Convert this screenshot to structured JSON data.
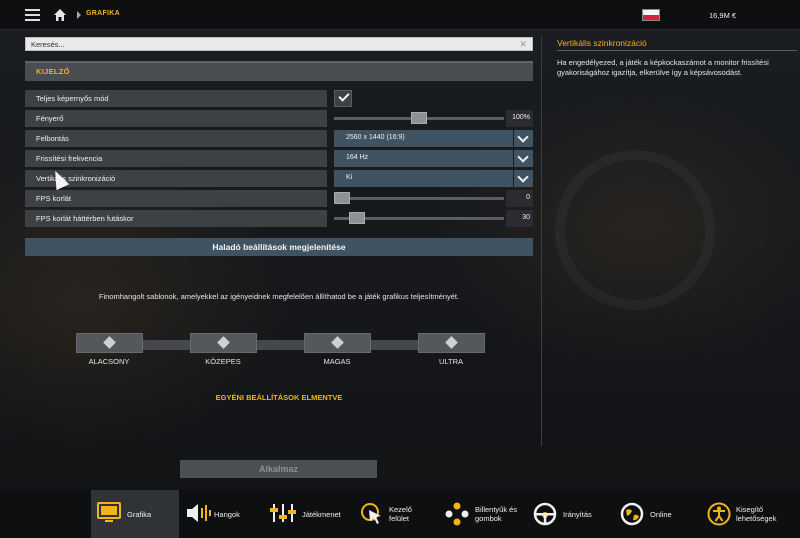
{
  "topbar": {
    "breadcrumb": "GRAFIKA",
    "money": "16,9M €"
  },
  "search": {
    "placeholder": "Keresés..."
  },
  "section": {
    "title": "KIJELZŐ"
  },
  "settings": [
    {
      "label": "Teljes képernyős mód",
      "type": "checkbox",
      "checked": true
    },
    {
      "label": "Fényerő",
      "type": "slider",
      "value": "100%",
      "fraction": 0.5
    },
    {
      "label": "Felbontás",
      "type": "select",
      "value": "2560 x 1440 (16:9)"
    },
    {
      "label": "Frissítési frekvencia",
      "type": "select",
      "value": "164 Hz"
    },
    {
      "label": "Vertikális szinkronizáció",
      "type": "select",
      "value": "Ki"
    },
    {
      "label": "FPS korlát",
      "type": "slider",
      "value": "0",
      "fraction": 0.0
    },
    {
      "label": "FPS korlát háttérben futáskor",
      "type": "slider",
      "value": "30",
      "fraction": 0.1
    }
  ],
  "advanced_button": "Haladó beállítások megjelenítése",
  "presets": {
    "description": "Finomhangolt sablonok, amelyekkel az igényeidnek megfelelően állíthatod be a játék grafikus teljesítményét.",
    "levels": [
      "ALACSONY",
      "KÖZEPES",
      "MAGAS",
      "ULTRA"
    ],
    "saved_label": "EGYÉNI BEÁLLÍTÁSOK ELMENTVE"
  },
  "apply_button": "Alkalmaz",
  "info": {
    "title": "Vertikális szinkronizáció",
    "text": "Ha engedélyezed, a játék a képkockaszámot a monitor frissítési gyakoriságához igazítja, elkerülve így a képsávosodást."
  },
  "nav": [
    {
      "label": "Grafika",
      "icon": "monitor-icon",
      "active": true
    },
    {
      "label": "Hangok",
      "icon": "speaker-icon",
      "active": false
    },
    {
      "label": "Játékmenet",
      "icon": "sliders-icon",
      "active": false
    },
    {
      "label": "Kezelő\nfelület",
      "icon": "cursor-icon",
      "active": false
    },
    {
      "label": "Billentyűk és\ngombok",
      "icon": "gamepad-buttons-icon",
      "active": false
    },
    {
      "label": "Irányítás",
      "icon": "steering-wheel-icon",
      "active": false
    },
    {
      "label": "Online",
      "icon": "globe-icon",
      "active": false
    },
    {
      "label": "Kisegítő\nlehetőségek",
      "icon": "accessibility-icon",
      "active": false
    }
  ]
}
